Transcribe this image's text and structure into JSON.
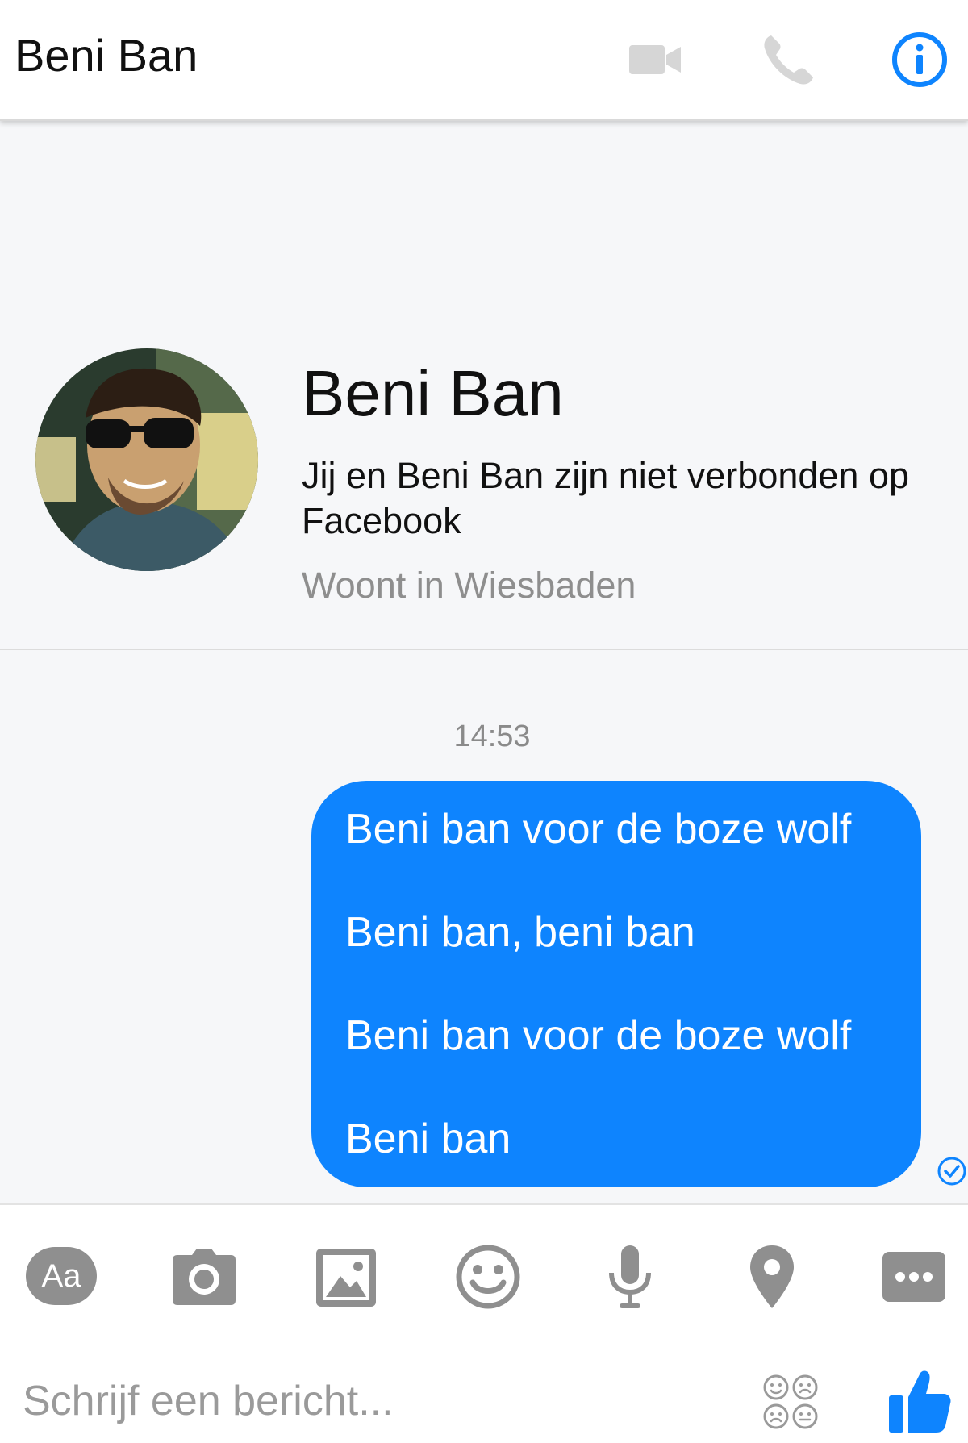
{
  "header": {
    "title": "Beni Ban",
    "icons": [
      "video-call-icon",
      "phone-icon",
      "info-icon"
    ]
  },
  "profile": {
    "name": "Beni Ban",
    "connection_text": "Jij en Beni Ban zijn niet verbonden op Facebook",
    "location": "Woont in Wiesbaden"
  },
  "conversation": {
    "timestamp": "14:53",
    "message_lines": [
      "Beni ban voor de boze wolf",
      "Beni ban, beni ban",
      "Beni ban voor de boze wolf",
      "Beni ban"
    ]
  },
  "composer": {
    "aa_label": "Aa",
    "placeholder": "Schrijf een bericht...",
    "tools": [
      "text-format",
      "camera-icon",
      "gallery-icon",
      "emoji-icon",
      "microphone-icon",
      "location-pin-icon",
      "more-icon",
      "sticker-icon",
      "like-icon"
    ]
  },
  "colors": {
    "accent": "#0e84fe",
    "disabled_icon": "#d6d6d6",
    "tool_icon": "#8f8f8f",
    "secondary_text": "#8e8e8e"
  }
}
